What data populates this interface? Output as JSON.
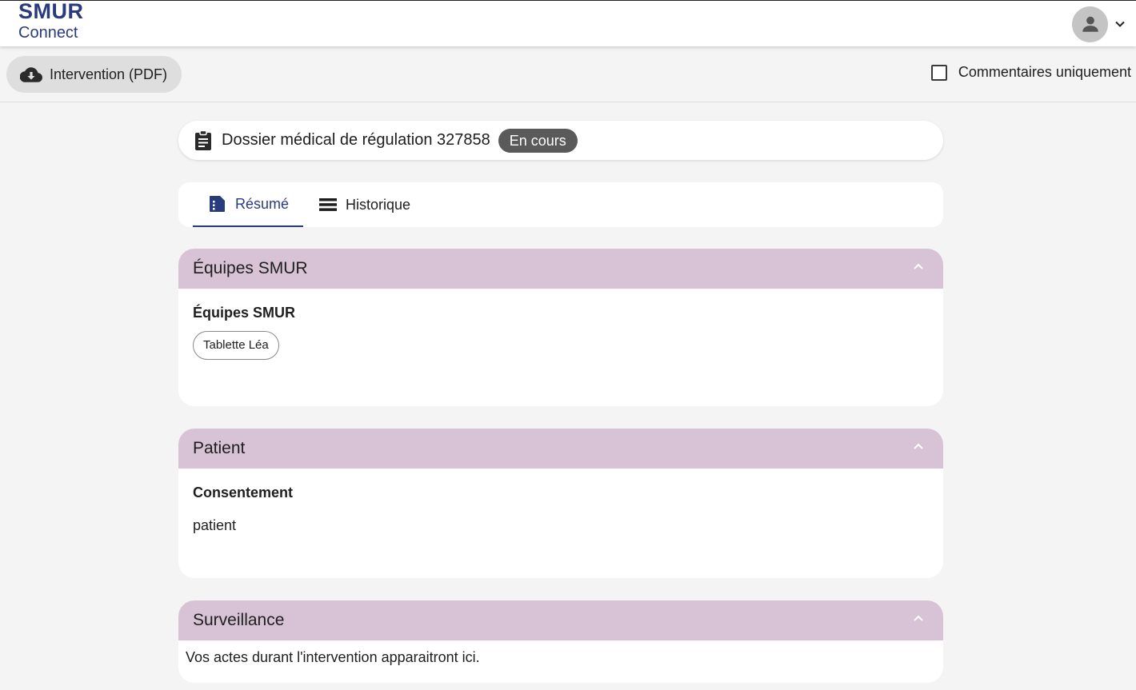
{
  "header": {
    "logo_top": "SMUR",
    "logo_bottom": "Connect"
  },
  "toolbar": {
    "pdf_button_label": "Intervention (PDF)",
    "comments_only_label": "Commentaires uniquement",
    "comments_only_checked": false
  },
  "dossier": {
    "title": "Dossier médical de régulation 327858",
    "status": "En cours"
  },
  "tabs": [
    {
      "label": "Résumé",
      "active": true
    },
    {
      "label": "Historique",
      "active": false
    }
  ],
  "sections": {
    "equipes": {
      "title": "Équipes SMUR",
      "field_label": "Équipes SMUR",
      "chip": "Tablette Léa"
    },
    "patient": {
      "title": "Patient",
      "field_label": "Consentement",
      "value": "patient"
    },
    "surveillance": {
      "title": "Surveillance",
      "message": "Vos actes durant l'intervention apparaitront ici."
    }
  },
  "colors": {
    "brand": "#283c7d",
    "section_header": "#d8c2d5",
    "badge": "#5a5a5a"
  }
}
